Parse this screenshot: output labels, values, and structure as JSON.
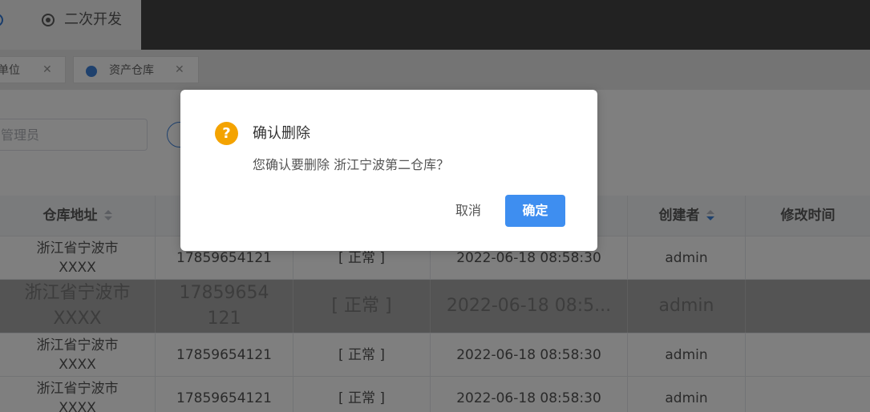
{
  "nav": {
    "active_tab_label": "二次开发"
  },
  "tags": [
    {
      "label": "单位",
      "close": "✕"
    },
    {
      "label": "资产仓库",
      "close": "✕"
    }
  ],
  "filter": {
    "placeholder_fragment": "管理员"
  },
  "table": {
    "headers": {
      "address": "仓库地址",
      "creator": "创建者",
      "modified_time": "修改时间"
    },
    "rows": [
      {
        "address": "浙江省宁波市XXXX",
        "phone": "17859654121",
        "status": "[ 正常 ]",
        "created": "2022-06-18 08:58:30",
        "creator": "admin",
        "modified": ""
      },
      {
        "address": "浙江省宁波市XXXX",
        "phone": "17859654121",
        "status": "[ 正常 ]",
        "created": "2022-06-18 08:5...",
        "creator": "admin",
        "modified": ""
      },
      {
        "address": "浙江省宁波市XXXX",
        "phone": "17859654121",
        "status": "[ 正常 ]",
        "created": "2022-06-18 08:58:30",
        "creator": "admin",
        "modified": ""
      },
      {
        "address": "浙江省宁波市XXXX",
        "phone": "17859654121",
        "status": "[ 正常 ]",
        "created": "2022-06-18 08:58:30",
        "creator": "admin",
        "modified": ""
      }
    ]
  },
  "dialog": {
    "icon": "question-icon",
    "icon_glyph": "?",
    "title": "确认删除",
    "message": "您确认要删除 浙江宁波第二仓库？",
    "cancel_label": "取消",
    "confirm_label": "确定"
  },
  "colors": {
    "primary": "#3e8ef0",
    "warning": "#f4a300",
    "topbar": "#454545"
  }
}
